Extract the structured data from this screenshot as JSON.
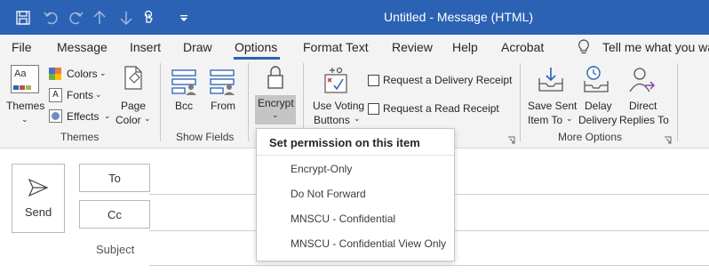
{
  "window": {
    "title": "Untitled  -  Message (HTML)"
  },
  "quick_access": {
    "icons": [
      "save-icon",
      "undo-icon",
      "redo-icon",
      "up-arrow-icon",
      "down-arrow-icon",
      "touch-mode-icon",
      "customize-icon"
    ]
  },
  "tabs": [
    {
      "label": "File"
    },
    {
      "label": "Message"
    },
    {
      "label": "Insert"
    },
    {
      "label": "Draw"
    },
    {
      "label": "Options"
    },
    {
      "label": "Format Text"
    },
    {
      "label": "Review"
    },
    {
      "label": "Help"
    },
    {
      "label": "Acrobat"
    }
  ],
  "tell_me": "Tell me what you wa",
  "ribbon": {
    "themes_group": {
      "label": "Themes",
      "themes_button": "Themes",
      "colors": "Colors",
      "fonts": "Fonts",
      "effects": "Effects",
      "page_color_line1": "Page",
      "page_color_line2": "Color"
    },
    "show_fields_group": {
      "label": "Show Fields",
      "bcc": "Bcc",
      "from": "From"
    },
    "encrypt_button": "Encrypt",
    "tracking": {
      "voting_line1": "Use Voting",
      "voting_line2": "Buttons",
      "delivery_receipt": "Request a Delivery Receipt",
      "read_receipt": "Request a Read Receipt"
    },
    "more_options_group": {
      "label": "More Options",
      "save_sent_line1": "Save Sent",
      "save_sent_line2": "Item To",
      "delay_line1": "Delay",
      "delay_line2": "Delivery",
      "direct_line1": "Direct",
      "direct_line2": "Replies To"
    }
  },
  "compose": {
    "send": "Send",
    "to": "To",
    "cc": "Cc",
    "subject": "Subject"
  },
  "encrypt_menu": {
    "title": "Set permission on this item",
    "items": [
      {
        "label": "Encrypt-Only"
      },
      {
        "label": "Do Not Forward"
      },
      {
        "label": "MNSCU - Confidential"
      },
      {
        "label": "MNSCU - Confidential View Only"
      }
    ]
  },
  "colors": {
    "titlebar": "#2b62b4",
    "ribbon": "#f3f3f3",
    "accent": "#2b62b4"
  }
}
